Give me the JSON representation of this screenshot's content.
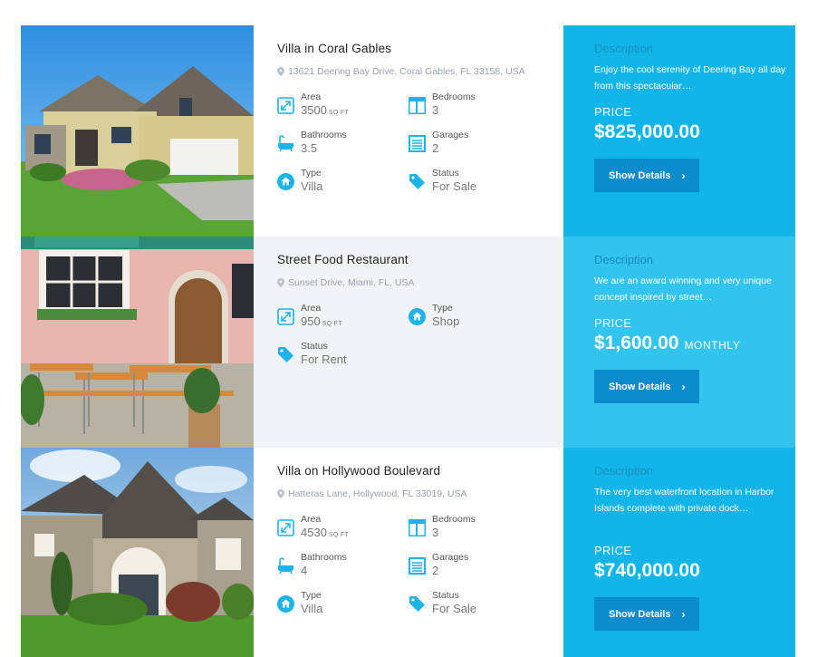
{
  "listings": [
    {
      "title": "Villa in Coral Gables",
      "address": "13621 Deering Bay Drive, Coral Gables, FL 33158, USA",
      "features": [
        {
          "icon": "area-icon",
          "label": "Area",
          "value": "3500",
          "unit": "SQ FT"
        },
        {
          "icon": "bedrooms-icon",
          "label": "Bedrooms",
          "value": "3"
        },
        {
          "icon": "bathtub-icon",
          "label": "Bathrooms",
          "value": "3.5"
        },
        {
          "icon": "garage-icon",
          "label": "Garages",
          "value": "2"
        },
        {
          "icon": "home-icon",
          "label": "Type",
          "value": "Villa"
        },
        {
          "icon": "tag-icon",
          "label": "Status",
          "value": "For Sale"
        }
      ],
      "description_heading": "Description",
      "description": "Enjoy the cool serenity of Deering Bay all day from this spectacular…",
      "price_label": "PRICE",
      "price": "$825,000.00",
      "price_suffix": "",
      "button_label": "Show Details"
    },
    {
      "title": "Street Food Restaurant",
      "address": "Sunset Drive, Miami, FL, USA",
      "features": [
        {
          "icon": "area-icon",
          "label": "Area",
          "value": "950",
          "unit": "SQ FT"
        },
        {
          "icon": "home-icon",
          "label": "Type",
          "value": "Shop"
        },
        {
          "icon": "tag-icon",
          "label": "Status",
          "value": "For Rent"
        }
      ],
      "description_heading": "Description",
      "description": "We are an award winning and very unique concept inspired by street…",
      "price_label": "PRICE",
      "price": "$1,600.00",
      "price_suffix": "MONTHLY",
      "button_label": "Show Details"
    },
    {
      "title": "Villa on Hollywood Boulevard",
      "address": "Hatteras Lane, Hollywood, FL 33019, USA",
      "features": [
        {
          "icon": "area-icon",
          "label": "Area",
          "value": "4530",
          "unit": "SQ FT"
        },
        {
          "icon": "bedrooms-icon",
          "label": "Bedrooms",
          "value": "3"
        },
        {
          "icon": "bathtub-icon",
          "label": "Bathrooms",
          "value": "4"
        },
        {
          "icon": "garage-icon",
          "label": "Garages",
          "value": "2"
        },
        {
          "icon": "home-icon",
          "label": "Type",
          "value": "Villa"
        },
        {
          "icon": "tag-icon",
          "label": "Status",
          "value": "For Sale"
        }
      ],
      "description_heading": "Description",
      "description": "The very best waterfront location in Harbor Islands complete with private dock…",
      "price_label": "PRICE",
      "price": "$740,000.00",
      "price_suffix": "",
      "button_label": "Show Details"
    }
  ],
  "colors": {
    "accent": "#12b5e8",
    "accent_light": "#32c3ee",
    "button": "#0c8ccd",
    "icon": "#1cb3e6"
  }
}
